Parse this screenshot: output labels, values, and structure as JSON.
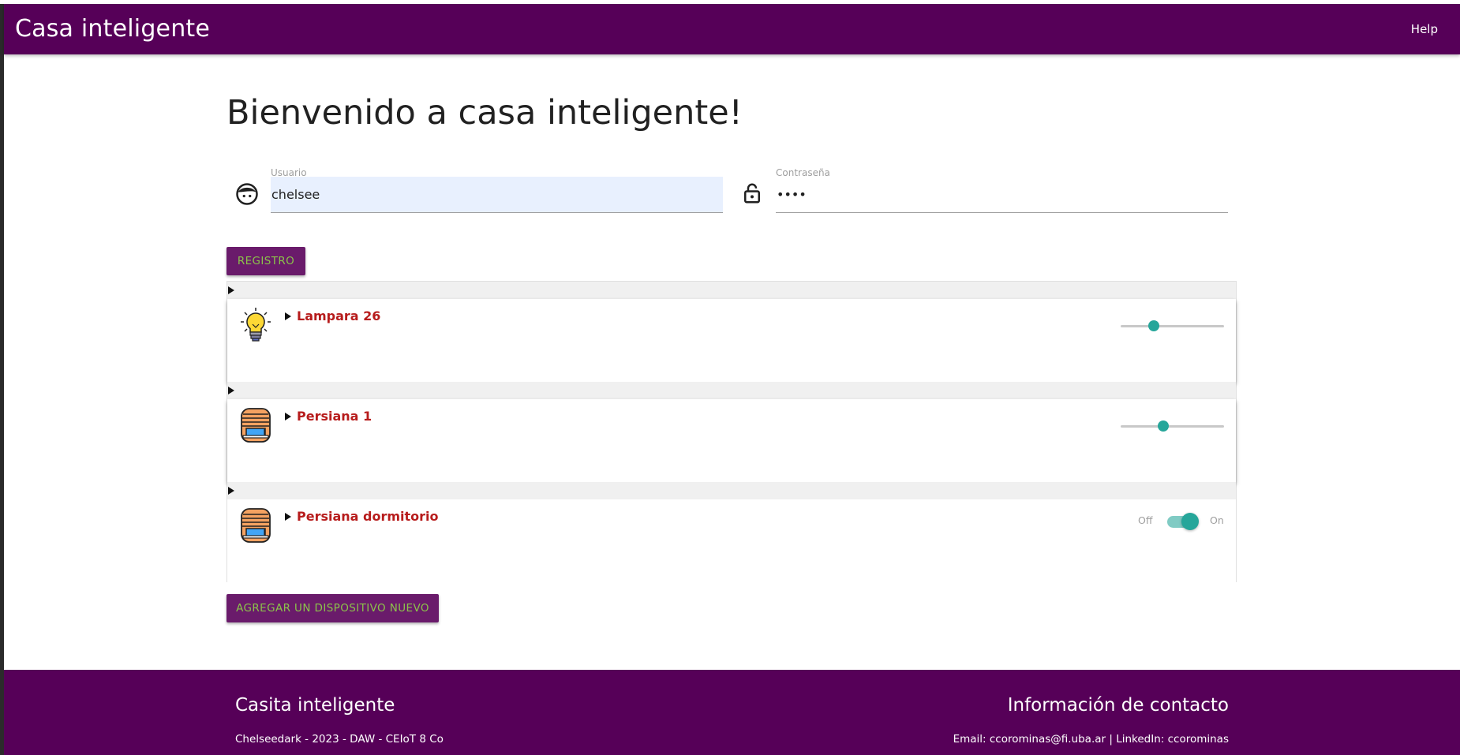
{
  "navbar": {
    "brand": "Casa inteligente",
    "help": "Help"
  },
  "main": {
    "title": "Bienvenido a casa inteligente!",
    "user_field": {
      "label": "Usuario",
      "value": "chelsee",
      "icon": "face-icon"
    },
    "password_field": {
      "label": "Contraseña",
      "value": "••••",
      "icon": "lock-open-icon"
    },
    "register_button": "REGISTRO",
    "add_device_button": "AGREGAR UN DISPOSITIVO NUEVO"
  },
  "devices": [
    {
      "name": "Lampara 26",
      "icon": "lightbulb-icon",
      "control": "slider",
      "level": 0.32
    },
    {
      "name": "Persiana 1",
      "icon": "window-blind-icon",
      "control": "slider",
      "level": 0.41
    },
    {
      "name": "Persiana dormitorio",
      "icon": "window-blind-icon",
      "control": "switch",
      "off_label": "Off",
      "on_label": "On",
      "state": "on"
    }
  ],
  "footer": {
    "left_title": "Casita inteligente",
    "left_text": "Chelseedark - 2023 - DAW - CEIoT 8 Co",
    "right_title": "Información de contacto",
    "right_text": "Email: ccorominas@fi.uba.ar | LinkedIn: ccorominas"
  },
  "colors": {
    "primary": "#560058",
    "button_bg": "#6a1b6b",
    "button_text": "#8bc34a",
    "device_name": "#b71c1c",
    "accent": "#26a69a"
  }
}
